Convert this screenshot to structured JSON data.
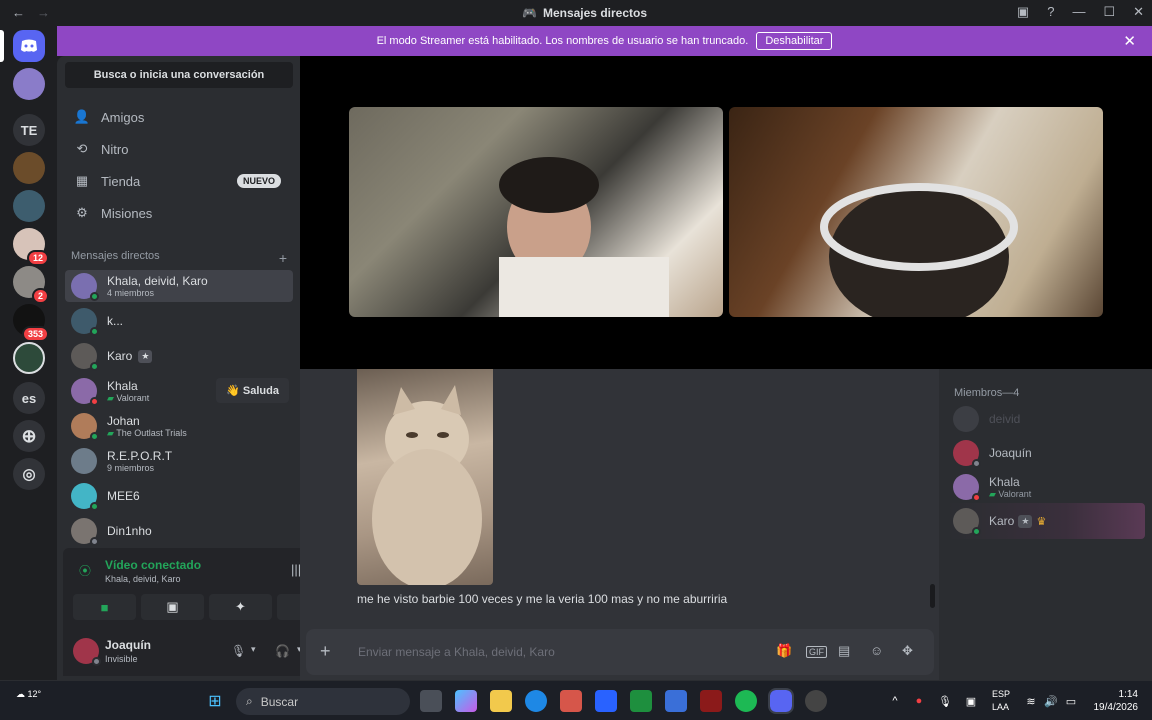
{
  "window": {
    "title": "Mensajes directos"
  },
  "banner": {
    "text": "El modo Streamer está habilitado. Los nombres de usuario se han truncado.",
    "button": "Deshabilitar"
  },
  "servers": [
    {
      "label": "TE"
    },
    {
      "label": "12"
    },
    {
      "label": "2"
    },
    {
      "label": "353"
    },
    {
      "label": "es"
    }
  ],
  "sidebar": {
    "search": "Busca o inicia una conversación",
    "nav": [
      {
        "label": "Amigos",
        "icon": "friends-icon"
      },
      {
        "label": "Nitro",
        "icon": "nitro-icon"
      },
      {
        "label": "Tienda",
        "icon": "shop-icon",
        "badge": "NUEVO"
      },
      {
        "label": "Misiones",
        "icon": "quests-icon"
      }
    ],
    "dm_header": "Mensajes directos",
    "dms": [
      {
        "name": "Khala, deivid, Karo",
        "sub": "4 miembros",
        "selected": true
      },
      {
        "name": "k...",
        "sub": ""
      },
      {
        "name": "Karo",
        "sub": ""
      },
      {
        "name": "Khala",
        "sub": "Valorant",
        "action": "Saluda"
      },
      {
        "name": "Johan",
        "sub": "The Outlast Trials"
      },
      {
        "name": "R.E.P.O.R.T",
        "sub": "9 miembros"
      },
      {
        "name": "MEE6",
        "sub": ""
      },
      {
        "name": "Din1nho",
        "sub": ""
      }
    ]
  },
  "voice": {
    "title": "Vídeo conectado",
    "sub": "Khala, deivid, Karo"
  },
  "user": {
    "name": "Joaquín",
    "status": "Invisible"
  },
  "chat": {
    "message": "me he visto barbie 100 veces y me la veria 100 mas y no me aburriria",
    "placeholder": "Enviar mensaje a Khala, deivid, Karo"
  },
  "members": {
    "header": "Miembros—4",
    "list": [
      {
        "name": "deivid",
        "sub": ""
      },
      {
        "name": "Joaquín",
        "sub": ""
      },
      {
        "name": "Khala",
        "sub": "Valorant"
      },
      {
        "name": "Karo",
        "sub": ""
      }
    ]
  },
  "taskbar": {
    "weather": "12°",
    "search": "Buscar",
    "lang1": "ESP",
    "lang2": "LAA",
    "time": "1:14",
    "date": "19/4/2026"
  },
  "colors": {
    "accent": "#5865f2",
    "banner": "#8f47c4",
    "online": "#23a55a",
    "dnd": "#f23f43"
  }
}
